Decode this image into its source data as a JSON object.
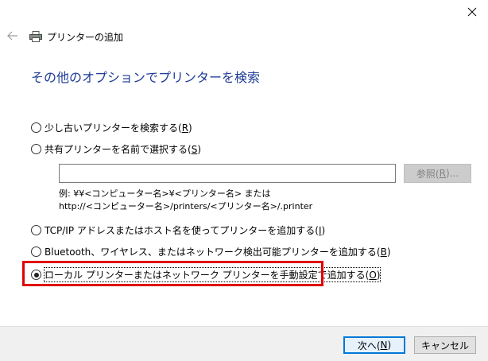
{
  "window": {
    "title": "プリンターの追加"
  },
  "heading": "その他のオプションでプリンターを検索",
  "options": [
    {
      "label": "少し古いプリンターを検索する(",
      "key": "R",
      "suffix": ")",
      "checked": false
    },
    {
      "label": "共有プリンターを名前で選択する(",
      "key": "S",
      "suffix": ")",
      "checked": false
    },
    {
      "label": "TCP/IP アドレスまたはホスト名を使ってプリンターを追加する(",
      "key": "I",
      "suffix": ")",
      "checked": false
    },
    {
      "label": "Bluetooth、ワイヤレス、またはネットワーク検出可能プリンターを追加する(",
      "key": "B",
      "suffix": ")",
      "checked": false
    },
    {
      "label": "ローカル プリンターまたはネットワーク プリンターを手動設定で追加する(",
      "key": "O",
      "suffix": ")",
      "checked": true
    }
  ],
  "shared_printer": {
    "input_value": "",
    "browse_label_prefix": "参照(",
    "browse_key": "R",
    "browse_label_suffix": ")...",
    "example_line1": "例: ¥¥<コンピューター名>¥<プリンター名> または",
    "example_line2": "http://<コンピューター名>/printers/<プリンター名>/.printer"
  },
  "footer": {
    "next_prefix": "次へ(",
    "next_key": "N",
    "next_suffix": ")",
    "cancel_label": "キャンセル"
  },
  "colors": {
    "heading": "#1e3c96",
    "highlight": "#e00000",
    "primary_border": "#0078d7"
  }
}
